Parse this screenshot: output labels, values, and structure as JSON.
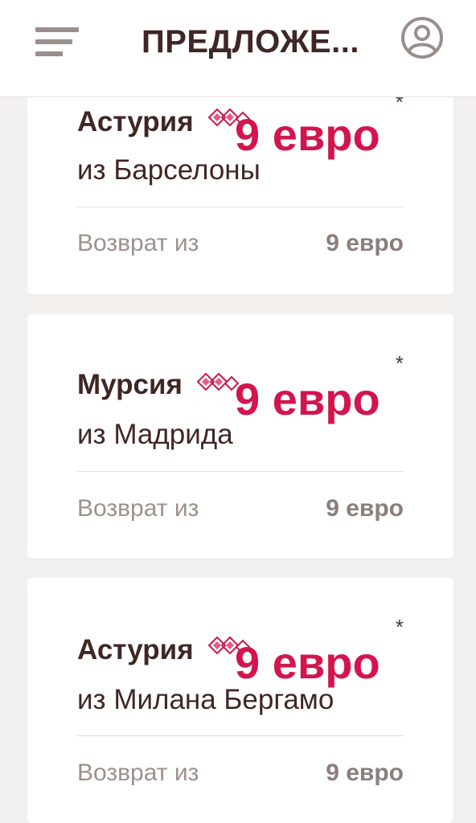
{
  "header": {
    "title": "ПРЕДЛОЖЕ...",
    "menu_icon": "hamburger-menu-icon",
    "user_icon": "user-profile-icon"
  },
  "colors": {
    "accent": "#d3154e",
    "text_dark": "#3f2725",
    "text_muted": "#9d918d",
    "background": "#f3f1f0"
  },
  "offers": [
    {
      "destination": "Астурия",
      "origin": "из Барселоны",
      "price": "9 евро",
      "asterisk": "*",
      "return_label": "Возврат из",
      "return_price": "9 евро"
    },
    {
      "destination": "Мурсия",
      "origin": "из Мадрида",
      "price": "9 евро",
      "asterisk": "*",
      "return_label": "Возврат из",
      "return_price": "9 евро"
    },
    {
      "destination": "Астурия",
      "origin": "из Милана Бергамо",
      "price": "9 евро",
      "asterisk": "*",
      "return_label": "Возврат из",
      "return_price": "9 евро"
    }
  ]
}
